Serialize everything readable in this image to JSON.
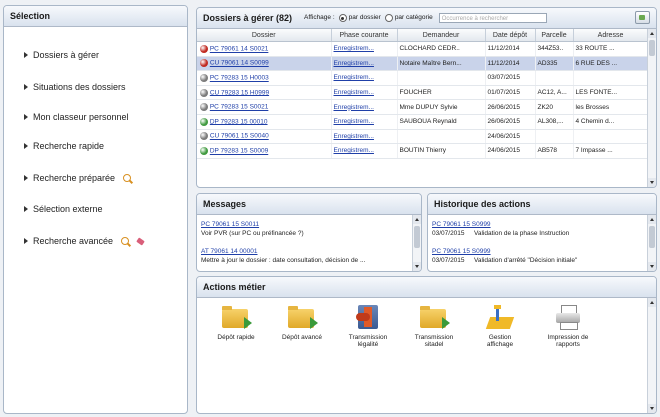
{
  "sidebar": {
    "title": "Sélection",
    "items": [
      {
        "label": "Dossiers à gérer"
      },
      {
        "label": "Situations des dossiers"
      },
      {
        "label": "Mon classeur personnel"
      },
      {
        "label": "Recherche rapide"
      },
      {
        "label": "Recherche préparée"
      },
      {
        "label": "Sélection externe"
      },
      {
        "label": "Recherche avancée"
      }
    ]
  },
  "dossiers": {
    "title": "Dossiers à gérer (82)",
    "affichage_label": "Affichage :",
    "radio_dossier": "par dossier",
    "radio_categorie": "par catégorie",
    "search_placeholder": "Occurrence à rechercher",
    "columns": [
      "Dossier",
      "Phase courante",
      "Demandeur",
      "Date dépôt",
      "Parcelle",
      "Adresse"
    ],
    "rows": [
      {
        "status": "#c0281f",
        "dossier": "PC 79061 14 S0021",
        "phase": "Enregistrem...",
        "demandeur": "CLOCHARD CEDR..",
        "date": "11/12/2014",
        "parcelle": "344Z53..",
        "adresse": "33 ROUTE ..."
      },
      {
        "status": "#c0281f",
        "dossier": "CU 79061 14 S0099",
        "phase": "Enregistrem...",
        "demandeur": "Notaire Maître Bern...",
        "date": "11/12/2014",
        "parcelle": "AD335",
        "adresse": "6 RUE DES ..."
      },
      {
        "status": "#7a7a7a",
        "dossier": "PC 79283 15 H0003",
        "phase": "Enregistrem...",
        "demandeur": "",
        "date": "03/07/2015",
        "parcelle": "",
        "adresse": ""
      },
      {
        "status": "#7a7a7a",
        "dossier": "CU 79283 15 H0999",
        "phase": "Enregistrem...",
        "demandeur": "FOUCHER",
        "date": "01/07/2015",
        "parcelle": "AC12, A...",
        "adresse": "LES FONTE..."
      },
      {
        "status": "#7a7a7a",
        "dossier": "PC 79283 15 S0021",
        "phase": "Enregistrem...",
        "demandeur": "Mme DUPUY Sylvie",
        "date": "26/06/2015",
        "parcelle": "ZK20",
        "adresse": "les Brosses"
      },
      {
        "status": "#3f9a3f",
        "dossier": "DP 79283 15 00010",
        "phase": "Enregistrem...",
        "demandeur": "SAUBOUA Reynald",
        "date": "26/06/2015",
        "parcelle": "AL308,...",
        "adresse": "4 Chemin d..."
      },
      {
        "status": "#7a7a7a",
        "dossier": "CU 79061 15 S0040",
        "phase": "Enregistrem...",
        "demandeur": "",
        "date": "24/06/2015",
        "parcelle": "",
        "adresse": ""
      },
      {
        "status": "#3f9a3f",
        "dossier": "DP 79283 15 S0009",
        "phase": "Enregistrem...",
        "demandeur": "BOUTIN Thierry",
        "date": "24/06/2015",
        "parcelle": "AB578",
        "adresse": "7 Impasse ..."
      }
    ]
  },
  "messages": {
    "title": "Messages",
    "items": [
      {
        "link": "PC 79061 15 S0011",
        "text": "Voir PVR (sur PC ou préfinancée ?)"
      },
      {
        "link": "AT 79061 14 00001",
        "text": "Mettre à jour le dossier : date consultation, décision de ..."
      }
    ]
  },
  "historique": {
    "title": "Historique des actions",
    "items": [
      {
        "link": "PC 79061 15 S0999",
        "date": "03/07/2015",
        "text": "Validation de la phase Instruction"
      },
      {
        "link": "PC 79061 15 S0999",
        "date": "03/07/2015",
        "text": "Validation d'arrêté \"Décision initiale\""
      }
    ]
  },
  "actions": {
    "title": "Actions métier",
    "items": [
      {
        "label": "Dépôt rapide",
        "icon": "folder-arrow-icon"
      },
      {
        "label": "Dépôt avancé",
        "icon": "folder-arrow-icon"
      },
      {
        "label": "Transmission légalité",
        "icon": "transmission-legalite-icon"
      },
      {
        "label": "Transmission sitadel",
        "icon": "folder-arrow-icon"
      },
      {
        "label": "Gestion affichage",
        "icon": "affichage-icon"
      },
      {
        "label": "Impression de rapports",
        "icon": "printer-icon"
      }
    ]
  }
}
